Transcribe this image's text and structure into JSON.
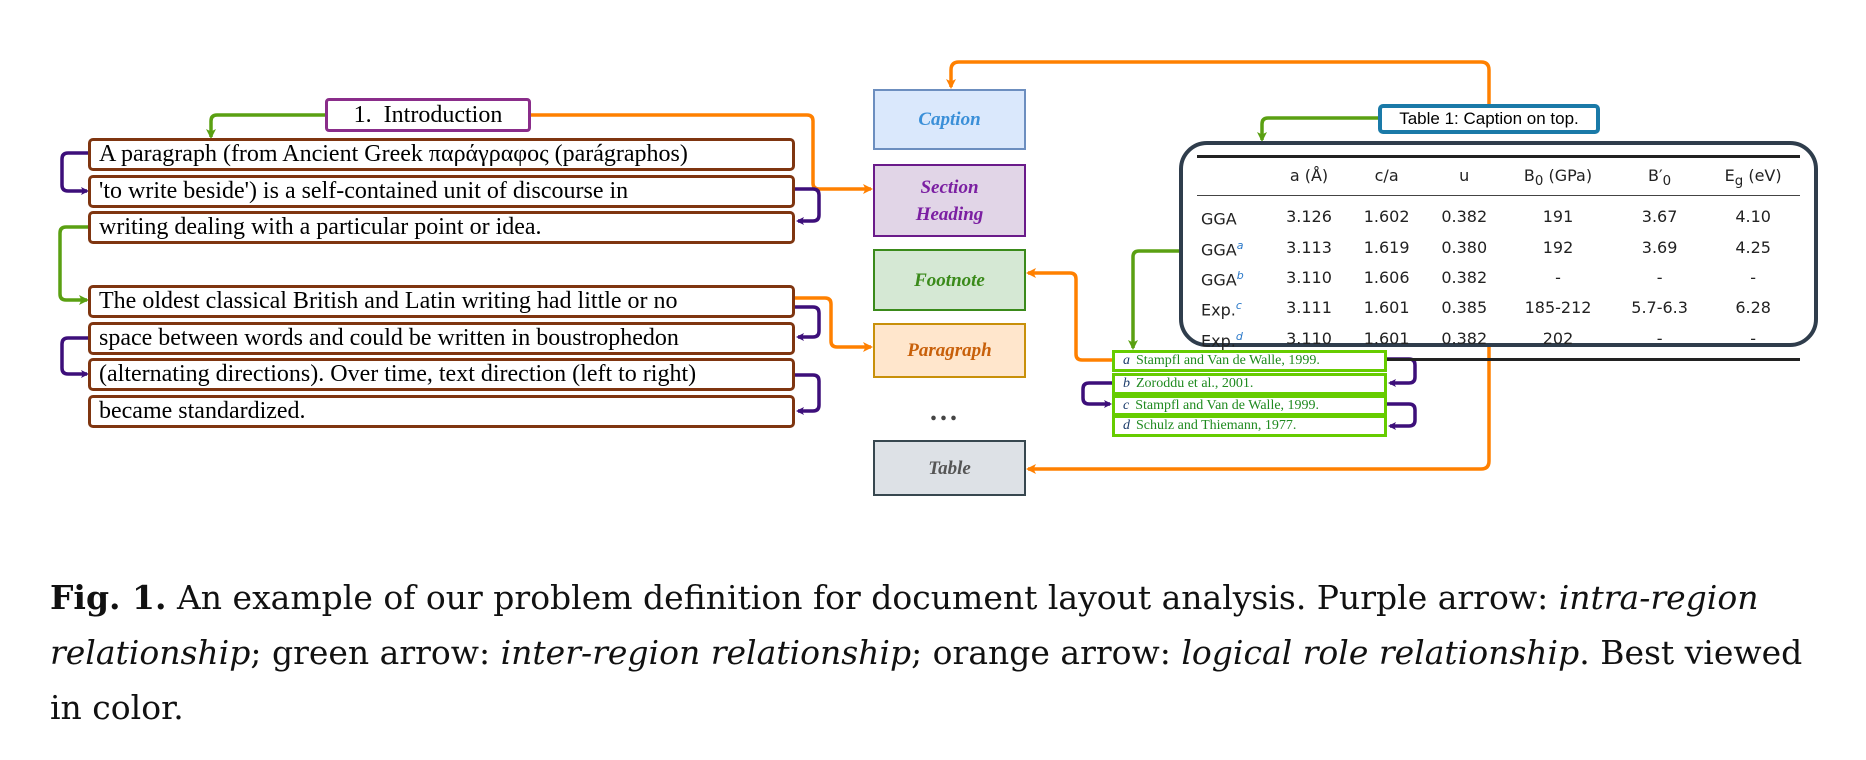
{
  "heading": {
    "text": "1.   Introduction"
  },
  "paragraph_group_1": [
    "A paragraph (from Ancient Greek παράγραφος (parágraphos)",
    "'to write beside') is a self-contained unit of discourse in",
    "writing dealing with a particular point or idea."
  ],
  "paragraph_group_2": [
    "The oldest classical British and Latin writing had little or no",
    "space between words and could be written in boustrophedon",
    "(alternating directions). Over time, text direction (left to right)",
    "became standardized."
  ],
  "categories": {
    "caption": {
      "label": "Caption",
      "fill": "#dae8fc",
      "stroke": "#6c8ebf",
      "text": "#3a8fd8"
    },
    "section_heading": {
      "label": "Section Heading",
      "fill": "#e1d5e7",
      "stroke": "#6a1b8a",
      "text": "#7b1fa2"
    },
    "footnote": {
      "label": "Footnote",
      "fill": "#d5e8d4",
      "stroke": "#3a8a1a",
      "text": "#3a8a1a"
    },
    "paragraph": {
      "label": "Paragraph",
      "fill": "#ffe6cc",
      "stroke": "#c8900a",
      "text": "#c8600a"
    },
    "ellipsis": "...",
    "table": {
      "label": "Table",
      "fill": "#dde1e6",
      "stroke": "#37474f",
      "text": "#555555"
    }
  },
  "table_caption": "Table 1: Caption on top.",
  "table": {
    "headers": [
      {
        "main": "",
        "sub": "",
        "rest": ""
      },
      {
        "main": "a (Å)",
        "sub": "",
        "rest": ""
      },
      {
        "main": "c/a",
        "sub": "",
        "rest": ""
      },
      {
        "main": "u",
        "sub": "",
        "rest": ""
      },
      {
        "main": "B",
        "sub": "0",
        "rest": " (GPa)"
      },
      {
        "main": "B′",
        "sub": "0",
        "rest": ""
      },
      {
        "main": "E",
        "sub": "g",
        "rest": " (eV)"
      }
    ],
    "rows": [
      {
        "label": "GGA",
        "sup": "",
        "cells": [
          "3.126",
          "1.602",
          "0.382",
          "191",
          "3.67",
          "4.10"
        ]
      },
      {
        "label": "GGA",
        "sup": "a",
        "cells": [
          "3.113",
          "1.619",
          "0.380",
          "192",
          "3.69",
          "4.25"
        ]
      },
      {
        "label": "GGA",
        "sup": "b",
        "cells": [
          "3.110",
          "1.606",
          "0.382",
          "-",
          "-",
          "-"
        ]
      },
      {
        "label": "Exp.",
        "sup": "c",
        "cells": [
          "3.111",
          "1.601",
          "0.385",
          "185-212",
          "5.7-6.3",
          "6.28"
        ]
      },
      {
        "label": "Exp.",
        "sup": "d",
        "cells": [
          "3.110",
          "1.601",
          "0.382",
          "202",
          "-",
          "-"
        ]
      }
    ]
  },
  "footnotes": [
    {
      "mark": "a",
      "text": "Stampfl and Van de Walle, 1999."
    },
    {
      "mark": "b",
      "text": "Zoroddu et al., 2001."
    },
    {
      "mark": "c",
      "text": "Stampfl and Van de Walle, 1999."
    },
    {
      "mark": "d",
      "text": "Schulz and Thiemann, 1977."
    }
  ],
  "arrow_colors": {
    "intra_region": "#3d0f7a",
    "inter_region": "#5aa012",
    "logical_role": "#ff8000"
  },
  "figure_caption": {
    "label": "Fig. 1.",
    "t1": " An example of our problem definition for document layout analysis. Purple arrow: ",
    "i1": "intra-region relationship",
    "t2": "; green arrow: ",
    "i2": "inter-region relationship",
    "t3": "; orange arrow: ",
    "i3": "logical role relationship",
    "t4": ". Best viewed in color."
  }
}
